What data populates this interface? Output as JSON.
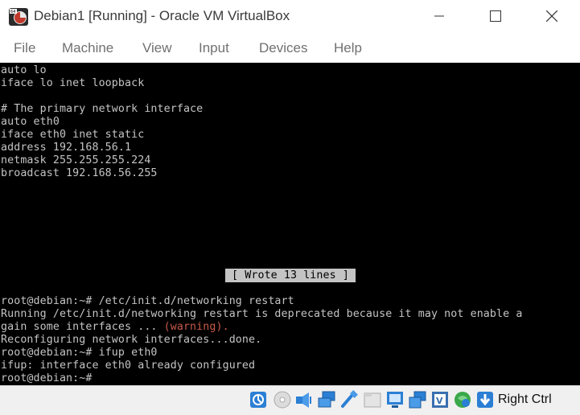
{
  "window": {
    "title": "Debian1 [Running] - Oracle VM VirtualBox",
    "app_icon": "virtualbox-vm-icon",
    "controls": [
      "minimize-icon",
      "maximize-icon",
      "close-icon"
    ]
  },
  "menu": {
    "items": [
      {
        "label": "File"
      },
      {
        "label": "Machine"
      },
      {
        "label": "View"
      },
      {
        "label": "Input"
      },
      {
        "label": "Devices"
      },
      {
        "label": "Help"
      }
    ]
  },
  "terminal": {
    "lines": [
      "auto lo",
      "iface lo inet loopback",
      "",
      "# The primary network interface",
      "auto eth0",
      "iface eth0 inet static",
      "address 192.168.56.1",
      "netmask 255.255.255.224",
      "broadcast 192.168.56.255"
    ],
    "nano_status": "[ Wrote 13 lines ]",
    "output": [
      "root@debian:~# /etc/init.d/networking restart",
      "Running /etc/init.d/networking restart is deprecated because it may not enable a",
      "gain some interfaces ... ",
      "Reconfiguring network interfaces...done.",
      "root@debian:~# ifup eth0",
      "ifup: interface eth0 already configured",
      "root@debian:~# "
    ],
    "warning_text": "(warning).",
    "text_color": "#c4c4c4",
    "warning_color": "#c85a4a",
    "background": "#000000"
  },
  "statusbar": {
    "icons": [
      "hard-disk-icon",
      "optical-drive-icon",
      "audio-icon",
      "network-icon",
      "usb-icon",
      "shared-folders-icon",
      "display-icon",
      "video-capture-icon",
      "vt-x-icon",
      "mouse-integration-icon",
      "host-key-arrow-icon"
    ],
    "host_key": "Right Ctrl"
  }
}
